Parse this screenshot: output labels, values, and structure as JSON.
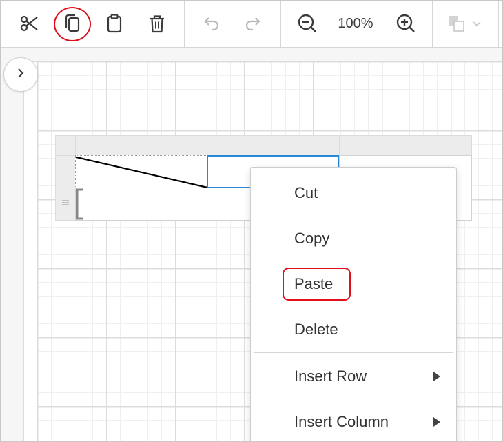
{
  "toolbar": {
    "zoom_level": "100%",
    "buttons": [
      {
        "name": "cut",
        "icon": "scissors-icon"
      },
      {
        "name": "copy",
        "icon": "copy-icon"
      },
      {
        "name": "paste",
        "icon": "clipboard-icon"
      },
      {
        "name": "delete",
        "icon": "trash-icon"
      },
      {
        "name": "undo",
        "icon": "undo-icon"
      },
      {
        "name": "redo",
        "icon": "redo-icon"
      },
      {
        "name": "zoom-out",
        "icon": "zoom-out-icon"
      },
      {
        "name": "zoom-in",
        "icon": "zoom-in-icon"
      },
      {
        "name": "fill-color",
        "icon": "fill-color-icon"
      }
    ],
    "highlight_color": "#e0101a"
  },
  "context_menu": {
    "items": [
      {
        "label": "Cut",
        "submenu": false
      },
      {
        "label": "Copy",
        "submenu": false
      },
      {
        "label": "Paste",
        "submenu": false
      },
      {
        "label": "Delete",
        "submenu": false
      },
      {
        "label": "Insert Row",
        "submenu": true
      },
      {
        "label": "Insert Column",
        "submenu": true
      }
    ]
  },
  "colors": {
    "accent_selection": "#2b88d8",
    "highlight": "#e0101a",
    "icon": "#3a3a3a",
    "disabled_icon": "#b8b8b8"
  }
}
